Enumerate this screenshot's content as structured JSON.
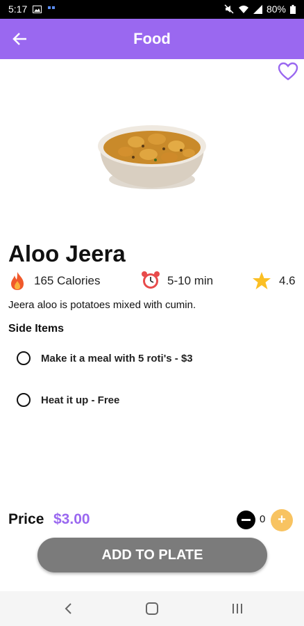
{
  "status_bar": {
    "time": "5:17",
    "battery": "80%"
  },
  "appbar": {
    "title": "Food"
  },
  "dish": {
    "name": "Aloo Jeera",
    "calories": "165 Calories",
    "time": "5-10 min",
    "rating": "4.6",
    "description": "Jeera aloo is potatoes mixed with cumin."
  },
  "side_items": {
    "title": "Side Items",
    "options": [
      {
        "label": "Make it a meal with 5 roti's - $3"
      },
      {
        "label": "Heat it up - Free"
      }
    ]
  },
  "price": {
    "label": "Price",
    "value": "$3.00"
  },
  "quantity": {
    "value": "0",
    "plus_symbol": "+"
  },
  "add_button": {
    "label": "ADD TO PLATE"
  },
  "colors": {
    "accent": "#9a68f0",
    "plus": "#f8c361",
    "button": "#7b7b7b"
  },
  "icons": [
    "back-arrow-icon",
    "heart-icon",
    "fire-icon",
    "alarm-clock-icon",
    "star-icon",
    "minus-icon",
    "plus-icon",
    "nav-back-icon",
    "nav-home-icon",
    "nav-recents-icon"
  ]
}
